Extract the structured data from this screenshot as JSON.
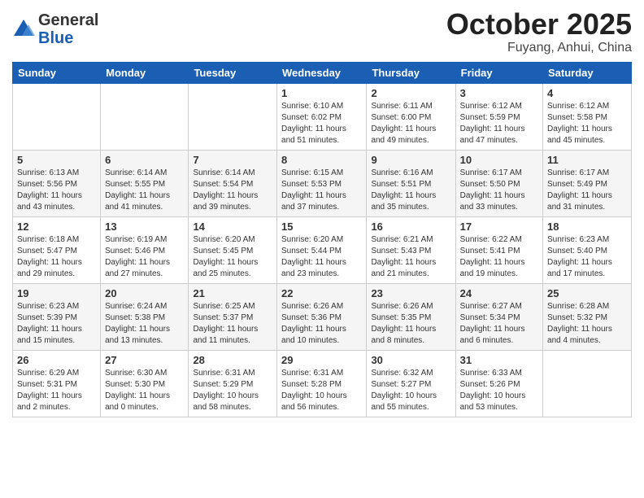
{
  "header": {
    "logo_general": "General",
    "logo_blue": "Blue",
    "month": "October 2025",
    "location": "Fuyang, Anhui, China"
  },
  "days_of_week": [
    "Sunday",
    "Monday",
    "Tuesday",
    "Wednesday",
    "Thursday",
    "Friday",
    "Saturday"
  ],
  "weeks": [
    [
      {
        "day": "",
        "info": ""
      },
      {
        "day": "",
        "info": ""
      },
      {
        "day": "",
        "info": ""
      },
      {
        "day": "1",
        "info": "Sunrise: 6:10 AM\nSunset: 6:02 PM\nDaylight: 11 hours\nand 51 minutes."
      },
      {
        "day": "2",
        "info": "Sunrise: 6:11 AM\nSunset: 6:00 PM\nDaylight: 11 hours\nand 49 minutes."
      },
      {
        "day": "3",
        "info": "Sunrise: 6:12 AM\nSunset: 5:59 PM\nDaylight: 11 hours\nand 47 minutes."
      },
      {
        "day": "4",
        "info": "Sunrise: 6:12 AM\nSunset: 5:58 PM\nDaylight: 11 hours\nand 45 minutes."
      }
    ],
    [
      {
        "day": "5",
        "info": "Sunrise: 6:13 AM\nSunset: 5:56 PM\nDaylight: 11 hours\nand 43 minutes."
      },
      {
        "day": "6",
        "info": "Sunrise: 6:14 AM\nSunset: 5:55 PM\nDaylight: 11 hours\nand 41 minutes."
      },
      {
        "day": "7",
        "info": "Sunrise: 6:14 AM\nSunset: 5:54 PM\nDaylight: 11 hours\nand 39 minutes."
      },
      {
        "day": "8",
        "info": "Sunrise: 6:15 AM\nSunset: 5:53 PM\nDaylight: 11 hours\nand 37 minutes."
      },
      {
        "day": "9",
        "info": "Sunrise: 6:16 AM\nSunset: 5:51 PM\nDaylight: 11 hours\nand 35 minutes."
      },
      {
        "day": "10",
        "info": "Sunrise: 6:17 AM\nSunset: 5:50 PM\nDaylight: 11 hours\nand 33 minutes."
      },
      {
        "day": "11",
        "info": "Sunrise: 6:17 AM\nSunset: 5:49 PM\nDaylight: 11 hours\nand 31 minutes."
      }
    ],
    [
      {
        "day": "12",
        "info": "Sunrise: 6:18 AM\nSunset: 5:47 PM\nDaylight: 11 hours\nand 29 minutes."
      },
      {
        "day": "13",
        "info": "Sunrise: 6:19 AM\nSunset: 5:46 PM\nDaylight: 11 hours\nand 27 minutes."
      },
      {
        "day": "14",
        "info": "Sunrise: 6:20 AM\nSunset: 5:45 PM\nDaylight: 11 hours\nand 25 minutes."
      },
      {
        "day": "15",
        "info": "Sunrise: 6:20 AM\nSunset: 5:44 PM\nDaylight: 11 hours\nand 23 minutes."
      },
      {
        "day": "16",
        "info": "Sunrise: 6:21 AM\nSunset: 5:43 PM\nDaylight: 11 hours\nand 21 minutes."
      },
      {
        "day": "17",
        "info": "Sunrise: 6:22 AM\nSunset: 5:41 PM\nDaylight: 11 hours\nand 19 minutes."
      },
      {
        "day": "18",
        "info": "Sunrise: 6:23 AM\nSunset: 5:40 PM\nDaylight: 11 hours\nand 17 minutes."
      }
    ],
    [
      {
        "day": "19",
        "info": "Sunrise: 6:23 AM\nSunset: 5:39 PM\nDaylight: 11 hours\nand 15 minutes."
      },
      {
        "day": "20",
        "info": "Sunrise: 6:24 AM\nSunset: 5:38 PM\nDaylight: 11 hours\nand 13 minutes."
      },
      {
        "day": "21",
        "info": "Sunrise: 6:25 AM\nSunset: 5:37 PM\nDaylight: 11 hours\nand 11 minutes."
      },
      {
        "day": "22",
        "info": "Sunrise: 6:26 AM\nSunset: 5:36 PM\nDaylight: 11 hours\nand 10 minutes."
      },
      {
        "day": "23",
        "info": "Sunrise: 6:26 AM\nSunset: 5:35 PM\nDaylight: 11 hours\nand 8 minutes."
      },
      {
        "day": "24",
        "info": "Sunrise: 6:27 AM\nSunset: 5:34 PM\nDaylight: 11 hours\nand 6 minutes."
      },
      {
        "day": "25",
        "info": "Sunrise: 6:28 AM\nSunset: 5:32 PM\nDaylight: 11 hours\nand 4 minutes."
      }
    ],
    [
      {
        "day": "26",
        "info": "Sunrise: 6:29 AM\nSunset: 5:31 PM\nDaylight: 11 hours\nand 2 minutes."
      },
      {
        "day": "27",
        "info": "Sunrise: 6:30 AM\nSunset: 5:30 PM\nDaylight: 11 hours\nand 0 minutes."
      },
      {
        "day": "28",
        "info": "Sunrise: 6:31 AM\nSunset: 5:29 PM\nDaylight: 10 hours\nand 58 minutes."
      },
      {
        "day": "29",
        "info": "Sunrise: 6:31 AM\nSunset: 5:28 PM\nDaylight: 10 hours\nand 56 minutes."
      },
      {
        "day": "30",
        "info": "Sunrise: 6:32 AM\nSunset: 5:27 PM\nDaylight: 10 hours\nand 55 minutes."
      },
      {
        "day": "31",
        "info": "Sunrise: 6:33 AM\nSunset: 5:26 PM\nDaylight: 10 hours\nand 53 minutes."
      },
      {
        "day": "",
        "info": ""
      }
    ]
  ]
}
